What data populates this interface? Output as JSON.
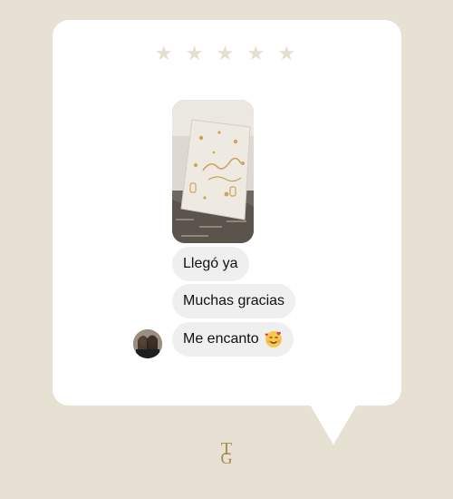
{
  "rating": {
    "stars": 5,
    "max": 5,
    "star_glyph": "★",
    "star_color": "#e4dfd0"
  },
  "photo": {
    "icon": "gift-box-photo"
  },
  "messages": [
    {
      "text": "Llegó ya"
    },
    {
      "text": "Muchas gracias"
    },
    {
      "text": "Me encanto",
      "emoji": "smiling-face-with-hearts-icon"
    }
  ],
  "sender": {
    "avatar": "avatar"
  },
  "brand": {
    "monogram_top": "T",
    "monogram_bottom": "G",
    "color": "#a58a4e"
  },
  "colors": {
    "background": "#e6e1d2",
    "card": "#ffffff",
    "bubble": "#efefef"
  }
}
